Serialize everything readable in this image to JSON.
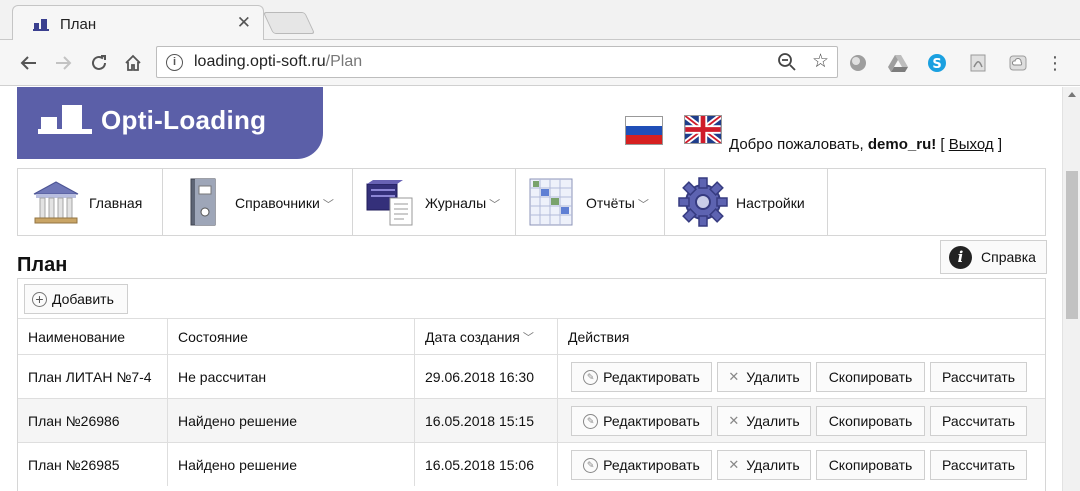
{
  "browser": {
    "tab_title": "План",
    "url_host": "loading.opti-soft.ru",
    "url_path": "/Plan"
  },
  "header": {
    "logo_text": "Opti-Loading",
    "welcome_prefix": "Добро пожаловать,",
    "username": "demo_ru!",
    "bracket_open": "[",
    "logout": "Выход",
    "bracket_close": "]"
  },
  "nav": {
    "items": [
      {
        "label": "Главная",
        "icon": "bank-icon",
        "dropdown": false
      },
      {
        "label": "Справочники",
        "icon": "binder-icon",
        "dropdown": true
      },
      {
        "label": "Журналы",
        "icon": "journal-icon",
        "dropdown": true
      },
      {
        "label": "Отчёты",
        "icon": "report-icon",
        "dropdown": true
      },
      {
        "label": "Настройки",
        "icon": "gear-icon",
        "dropdown": false
      }
    ]
  },
  "page": {
    "title": "План",
    "help_label": "Справка",
    "add_label": "Добавить"
  },
  "table": {
    "columns": [
      "Наименование",
      "Состояние",
      "Дата создания",
      "Действия"
    ],
    "rows": [
      {
        "name": "План ЛИТАН №7-4",
        "status": "Не рассчитан",
        "created": "29.06.2018 16:30"
      },
      {
        "name": "План №26986",
        "status": "Найдено решение",
        "created": "16.05.2018 15:15"
      },
      {
        "name": "План №26985",
        "status": "Найдено решение",
        "created": "16.05.2018 15:06"
      }
    ],
    "actions": {
      "edit": "Редактировать",
      "delete": "Удалить",
      "copy": "Скопировать",
      "calc": "Рассчитать"
    }
  },
  "colors": {
    "brand": "#5b5fa8"
  }
}
